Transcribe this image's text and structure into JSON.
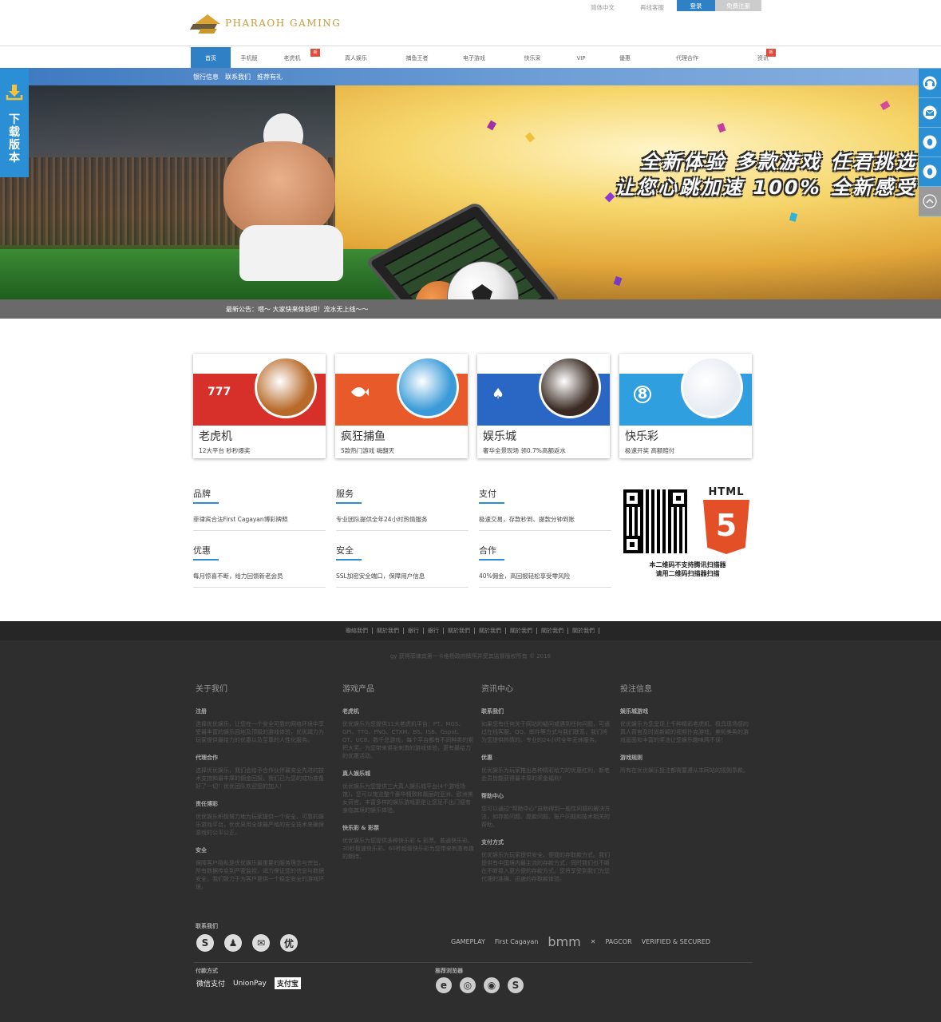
{
  "header": {
    "logo_text": "PHARAOH  GAMING",
    "lang": "简体中文",
    "service": "再线客服",
    "login": "登录",
    "register": "免费注册"
  },
  "nav": {
    "items": [
      {
        "label": "首页",
        "active": true,
        "new": false
      },
      {
        "label": "手机版",
        "active": false,
        "new": false
      },
      {
        "label": "老虎机",
        "active": false,
        "new": true
      },
      {
        "label": "真人娱乐",
        "active": false,
        "new": false
      },
      {
        "label": "捕鱼王者",
        "active": false,
        "new": false
      },
      {
        "label": "电子游戏",
        "active": false,
        "new": false
      },
      {
        "label": "快乐采",
        "active": false,
        "new": false
      },
      {
        "label": "VIP",
        "active": false,
        "new": false
      },
      {
        "label": "優惠",
        "active": false,
        "new": false
      },
      {
        "label": "代理合作",
        "active": false,
        "new": false
      },
      {
        "label": "资讯",
        "active": false,
        "new": true
      }
    ],
    "new_badge": "新"
  },
  "subnav": [
    "银行信息",
    "联系我们",
    "推荐有礼"
  ],
  "banner": {
    "line1": "全新体验  多款游戏  任君挑选",
    "line2": "让您心跳加速  100%  全新感受",
    "slide_count": 4,
    "active_slide": 1
  },
  "notice": "最新公告：喂～ 大家快来体验吧！流水无上线～～",
  "download": {
    "text": "下载版本"
  },
  "right_bar": [
    "headset-icon",
    "mail-icon",
    "qq-icon",
    "qq-icon",
    "back-to-top-icon"
  ],
  "cards": [
    {
      "name": "老虎机",
      "desc": "12大平台 秒秒爆奖",
      "color": "#d7302b",
      "circle": "#b86a2a"
    },
    {
      "name": "疯狂捕鱼",
      "desc": "5款热门游戏 嗨翻天",
      "color": "#e85a2a",
      "circle": "#3a9bd8"
    },
    {
      "name": "娱乐城",
      "desc": "奢华全景现场 领0.7%高额返水",
      "color": "#2a67c4",
      "circle": "#3a2a22"
    },
    {
      "name": "快乐彩",
      "desc": "极速开奖 高额赔付",
      "color": "#2f9fe0",
      "circle": "#e8edf3"
    }
  ],
  "features": [
    {
      "title": "品牌",
      "desc": "菲律宾合法First Cagayan博彩牌照"
    },
    {
      "title": "服务",
      "desc": "专业团队提供全年24小时热情服务"
    },
    {
      "title": "支付",
      "desc": "极速交易，存款秒到、提款分钟到账"
    },
    {
      "title": "优惠",
      "desc": "每月惊喜不断，给力回馈新老会员"
    },
    {
      "title": "安全",
      "desc": "SSL加密安全端口，保障用户信息"
    },
    {
      "title": "合作",
      "desc": "40%佣金，高回报轻松享受零风险"
    }
  ],
  "qr": {
    "html5_label": "HTML",
    "html5_number": "5",
    "caption1": "本二维码不支持腾讯扫描器",
    "caption2": "请用二维码扫描器扫描"
  },
  "footer": {
    "links": [
      "聯絡我們",
      "關於我們",
      "銀行",
      "銀行",
      "關於我們",
      "關於我們",
      "關於我們",
      "關於我們",
      "關於我們"
    ],
    "copyright": "gy 获得菲律宾第一卡格杨政府牌照并受其监督版权所有 © 2016",
    "columns": [
      {
        "title": "关于我们",
        "sections": [
          {
            "title": "注册",
            "text": "选择优优娱乐，让您在一个安全可靠的网络环境中享受最丰富的娱乐园地及顶级的游戏体验，优优竭力为玩家提供最给力的优惠以及至尊的人性化服务。"
          },
          {
            "title": "代理合作",
            "text": "选择优优娱乐，我们会给予合作伙伴最安全先进的技术支持和最丰厚的佣金回报，我们已为您的成功准备好了一切！优优团队欢迎您的加入！"
          },
          {
            "title": "责任博彩",
            "text": "优优娱乐积极努力地为玩家提供一个安全、可靠的娱乐游戏平台，优优采用全球最严格的安全技术来确保游戏的公平公正。"
          },
          {
            "title": "安全",
            "text": "保障客户隐私是优优娱乐最重要的服务理念与宗旨，所有数据传变到严密监控，竭力保证您的信息与数据安全。我们致力于为客户提供一个稳定安全的游戏环境。"
          }
        ]
      },
      {
        "title": "游戏产品",
        "sections": [
          {
            "title": "老虎机",
            "text": "优优娱乐为您提供11大老虎机平台：PT、MGS、GPI、TTG、PNG、CTXM、BS、ISB、Gspot、QT、UC8，数千总游戏，每个平台都有不同种类的累积大奖。为您带来紧张刺激的游戏体验，更有最给力的优惠活动。"
          },
          {
            "title": "真人娱乐城",
            "text": "优优娱乐为您提供三大真人娱乐城平台(4个游戏场馆)，您可以饱览整个豪华精致和靓丽的亚洲、欧洲美女荷官。丰富多样的娱乐游戏更是让您足不出门便有身临其境的娱乐体验。"
          },
          {
            "title": "快乐彩 & 彩票",
            "text": "优优娱乐为您提供多种快乐彩 & 彩票。普通快乐彩、30秒极速快乐彩、60秒超级快乐彩为您带来刺激有趣的期待。"
          }
        ]
      },
      {
        "title": "资讯中心",
        "sections": [
          {
            "title": "联系我们",
            "text": "如果您有任何关于网站的疑问或遇到任何问题，可通过在线客服、QQ、邮件等方式与我们联系，我们将为您提供热情的、专业的24小时全年无休服务。"
          },
          {
            "title": "优惠",
            "text": "优优娱乐为玩家推出各种精彩给力的优惠红利，新老会员皆能获得最丰厚的奖金福利！"
          },
          {
            "title": "帮助中心",
            "text": "您可以通过“帮助中心”自助得到一般性问题的解决方法，如存款问题、提款问题、账户问题和技术相关的帮助。"
          },
          {
            "title": "支付方式",
            "text": "优优娱乐为玩家提供安全、便捷的存取款方式。我们提供有中国境内最主流的存款方式，同时我们也不断在不断接入更方便的存款方式。您将享受到我们为您代理的准确、迅速的存取款体验。"
          }
        ]
      },
      {
        "title": "投注信息",
        "sections": [
          {
            "title": "娱乐城游戏",
            "text": "优优娱乐为您呈现上千种精彩老虎机、极具现场感的真人荷官及时尚新颖的视频扑克游戏，美轮美奂的游戏画面和丰富的奖池让您娱乐趣味两不误！"
          },
          {
            "title": "游戏规则",
            "text": "所有在优优娱乐投注都需要遵从本网站的规则条款。"
          }
        ]
      }
    ],
    "contact_title": "联系我们",
    "contact_icons": [
      {
        "name": "skype-icon",
        "glyph": "S"
      },
      {
        "name": "qq-icon",
        "glyph": "♟"
      },
      {
        "name": "mail-icon",
        "glyph": "✉"
      },
      {
        "name": "youyou-icon",
        "glyph": "优"
      }
    ],
    "partners": [
      "GAMEPLAY",
      "First Cagayan",
      "bmm",
      "✕",
      "PAGCOR",
      "VERIFIED & SECURED"
    ],
    "pay_title": "付款方式",
    "pay_methods": [
      "微信支付",
      "UnionPay",
      "支付宝"
    ],
    "browser_title": "推荐浏览器",
    "browsers": [
      {
        "name": "ie-icon",
        "glyph": "e"
      },
      {
        "name": "chrome-icon",
        "glyph": "◎"
      },
      {
        "name": "firefox-icon",
        "glyph": "◉"
      },
      {
        "name": "safari-icon",
        "glyph": "S"
      }
    ]
  }
}
